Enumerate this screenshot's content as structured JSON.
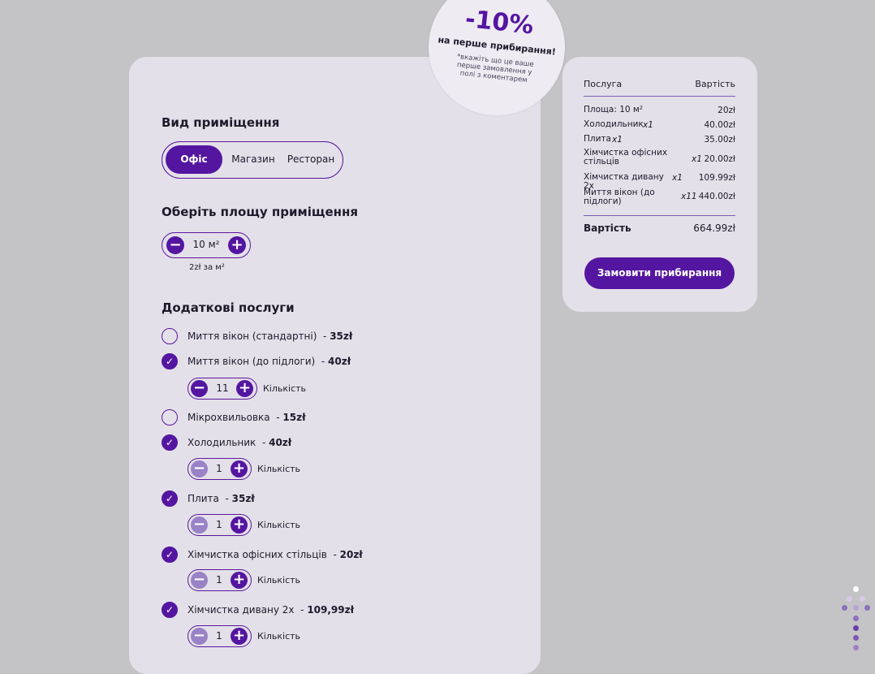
{
  "promo": {
    "discount": "-10%",
    "headline": "на перше прибирання!",
    "note": "*вкажіть що це ваше перше замовлення у полі з коментарем"
  },
  "room_type": {
    "title": "Вид приміщення",
    "options": [
      "Офіс",
      "Магазин",
      "Ресторан"
    ],
    "selected": "Офіс"
  },
  "area": {
    "title": "Оберіть площу приміщення",
    "value": "10 м²",
    "price_note": "2zł за м²"
  },
  "extras": {
    "title": "Додаткові послуги",
    "quantity_label": "Кількість",
    "items": [
      {
        "name": "Миття вікон (стандартні)",
        "price": "35zł",
        "checked": false
      },
      {
        "name": "Миття вікон (до підлоги)",
        "price": "40zł",
        "checked": true,
        "qty": "11"
      },
      {
        "name": "Мікрохвильовка",
        "price": "15zł",
        "checked": false
      },
      {
        "name": "Холодильник",
        "price": "40zł",
        "checked": true,
        "qty": "1"
      },
      {
        "name": "Плита",
        "price": "35zł",
        "checked": true,
        "qty": "1"
      },
      {
        "name": "Хімчистка офісних стільців",
        "price": "20zł",
        "checked": true,
        "qty": "1"
      },
      {
        "name": "Хімчистка дивану 2х",
        "price": "109,99zł",
        "checked": true,
        "qty": "1"
      }
    ]
  },
  "summary": {
    "col_service": "Послуга",
    "col_cost": "Вартість",
    "rows": [
      {
        "name": "Площа: 10 м²",
        "mult": "",
        "price": "20zł"
      },
      {
        "name": "Холодильник",
        "mult": "x1",
        "price": "40.00zł"
      },
      {
        "name": "Плита",
        "mult": "x1",
        "price": "35.00zł"
      },
      {
        "name": "Хімчистка офісних стільців",
        "mult": "x1",
        "price": "20.00zł"
      },
      {
        "name": "Хімчистка дивану 2х",
        "mult": "x1",
        "price": "109.99zł"
      },
      {
        "name": "Миття вікон (до підлоги)",
        "mult": "x11",
        "price": "440.00zł"
      }
    ],
    "total_label": "Вартість",
    "total_value": "664.99zł",
    "order_button": "Замовити прибирання"
  },
  "colors": {
    "accent": "#5416a0",
    "card": "#e3e0e9",
    "background": "#c4c4c6"
  }
}
